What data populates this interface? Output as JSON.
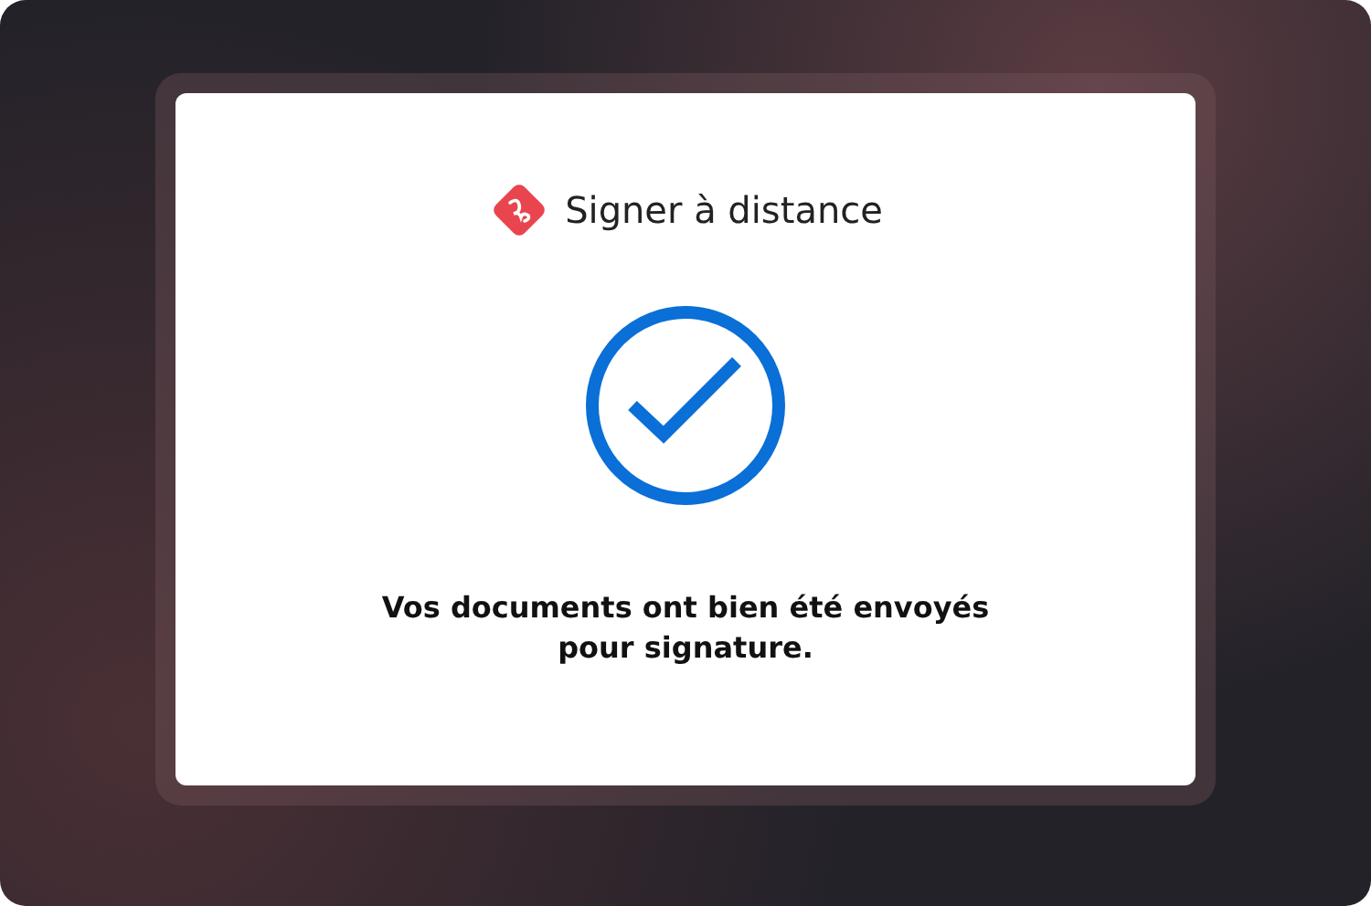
{
  "app": {
    "name": "Signer à distance"
  },
  "status": {
    "kind": "success",
    "message": "Vos documents ont bien été envoyés pour signature."
  }
}
